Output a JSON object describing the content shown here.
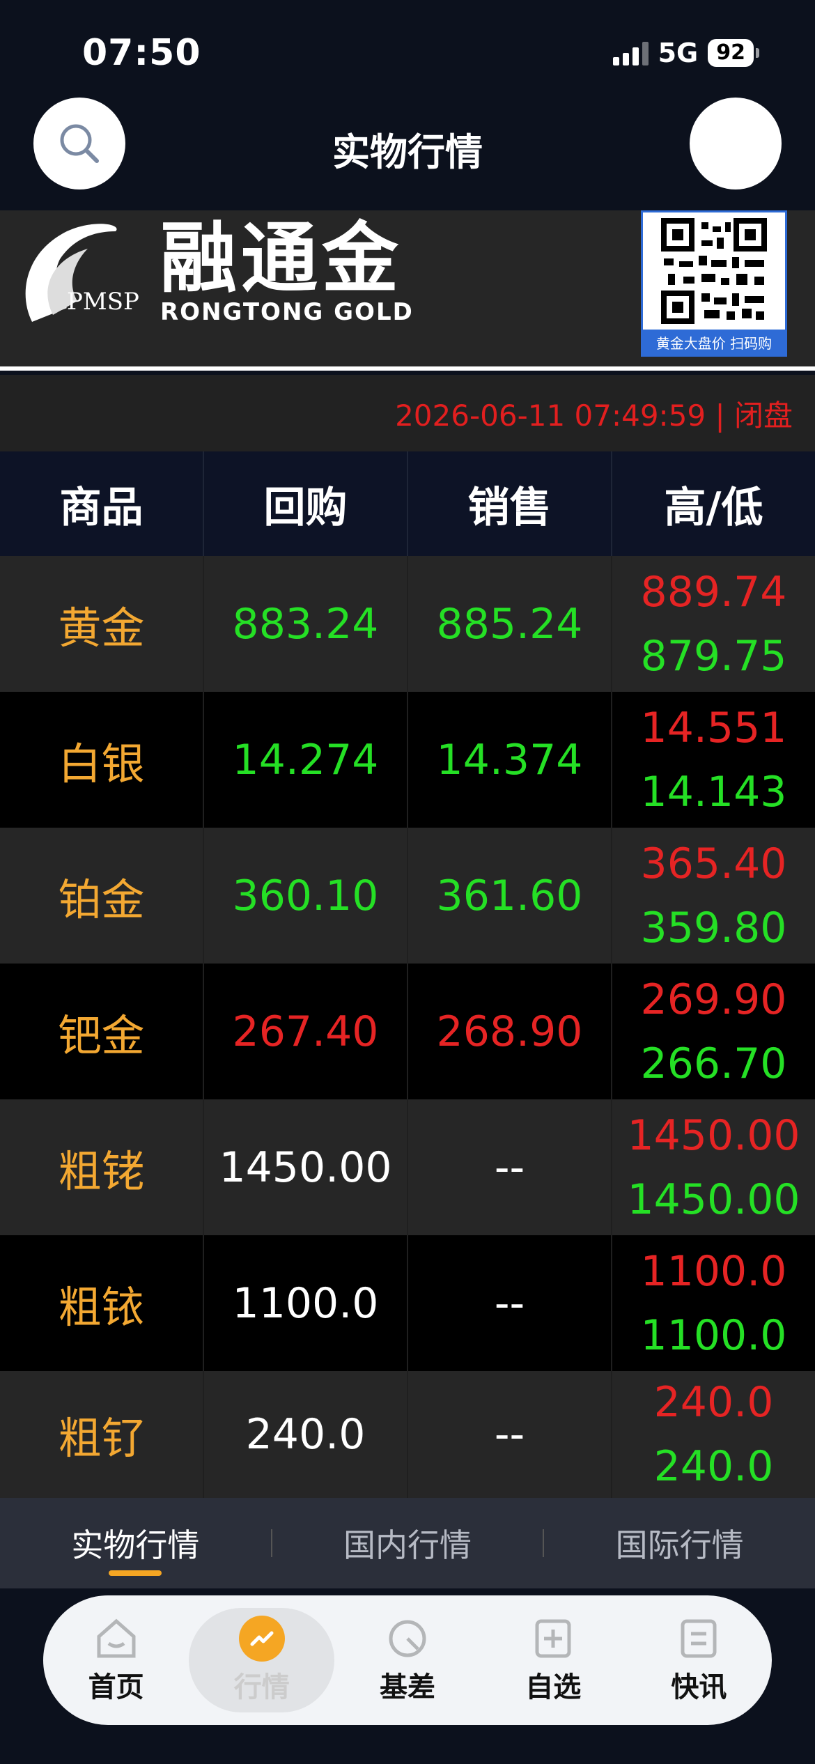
{
  "status": {
    "time": "07:50",
    "network": "5G",
    "battery": "92"
  },
  "nav": {
    "title": "实物行情"
  },
  "banner": {
    "brand_prefix": "PMSP",
    "brand_cn": "融通金",
    "brand_en": "RONGTONG GOLD",
    "qr_caption": "黄金大盘价 扫码购"
  },
  "datetime": "2026-06-11 07:49:59 | 闭盘",
  "table": {
    "headers": [
      "商品",
      "回购",
      "销售",
      "高/低"
    ],
    "rows": [
      {
        "name": "黄金",
        "buyback": "883.24",
        "sell": "885.24",
        "high": "889.74",
        "low": "879.75",
        "color": "green"
      },
      {
        "name": "白银",
        "buyback": "14.274",
        "sell": "14.374",
        "high": "14.551",
        "low": "14.143",
        "color": "green"
      },
      {
        "name": "铂金",
        "buyback": "360.10",
        "sell": "361.60",
        "high": "365.40",
        "low": "359.80",
        "color": "green"
      },
      {
        "name": "钯金",
        "buyback": "267.40",
        "sell": "268.90",
        "high": "269.90",
        "low": "266.70",
        "color": "red"
      },
      {
        "name": "粗铑",
        "buyback": "1450.00",
        "sell": "--",
        "high": "1450.00",
        "low": "1450.00",
        "color": "white"
      },
      {
        "name": "粗铱",
        "buyback": "1100.0",
        "sell": "--",
        "high": "1100.0",
        "low": "1100.0",
        "color": "white"
      },
      {
        "name": "粗钌",
        "buyback": "240.0",
        "sell": "--",
        "high": "240.0",
        "low": "240.0",
        "color": "white"
      }
    ]
  },
  "subtabs": [
    "实物行情",
    "国内行情",
    "国际行情"
  ],
  "bottom_nav": [
    "首页",
    "行情",
    "基差",
    "自选",
    "快讯"
  ],
  "colors": {
    "up": "#e62424",
    "down": "#25e025",
    "name": "#f3a832",
    "accent": "#f5a623"
  }
}
